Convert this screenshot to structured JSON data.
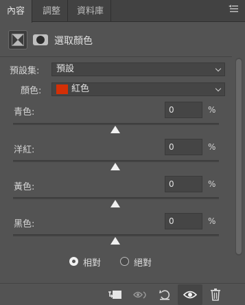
{
  "tabs": [
    {
      "label": "內容",
      "active": true
    },
    {
      "label": "調整",
      "active": false
    },
    {
      "label": "資料庫",
      "active": false
    }
  ],
  "tab_menu_icon": "panel-menu-icon",
  "header": {
    "title": "選取顏色",
    "icons": [
      "layer-mask-icon",
      "selective-color-adjustment-icon"
    ]
  },
  "preset": {
    "label": "預設集:",
    "value": "預設"
  },
  "colors": {
    "label": "顏色:",
    "value": "紅色",
    "swatch_color": "#d42f06"
  },
  "sliders": [
    {
      "label": "青色:",
      "value": "0",
      "unit": "%"
    },
    {
      "label": "洋紅:",
      "value": "0",
      "unit": "%"
    },
    {
      "label": "黃色:",
      "value": "0",
      "unit": "%"
    },
    {
      "label": "黑色:",
      "value": "0",
      "unit": "%"
    }
  ],
  "method": {
    "options": [
      {
        "label": "相對",
        "selected": true
      },
      {
        "label": "絕對",
        "selected": false
      }
    ]
  },
  "bottom_icons": [
    "clip-to-layer-icon",
    "view-previous-state-icon",
    "reset-icon",
    "visibility-eye-icon",
    "trash-icon"
  ],
  "accent_colors": {
    "panel_bg": "#535353",
    "tabbar_bg": "#424242",
    "field_bg": "#454545"
  }
}
